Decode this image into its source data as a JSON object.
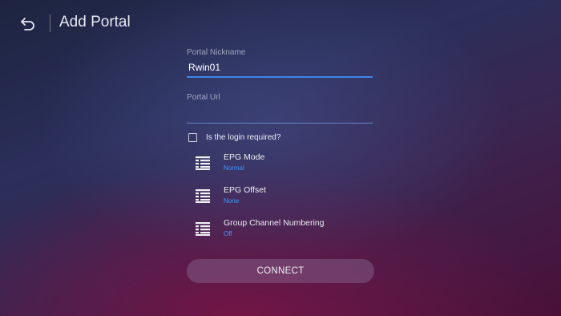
{
  "header": {
    "title": "Add Portal",
    "back_icon": "back-arrow-icon"
  },
  "form": {
    "nickname": {
      "label": "Portal Nickname",
      "value": "Rwin01"
    },
    "url": {
      "label": "Portal Url",
      "value": ""
    },
    "login_required": {
      "label": "Is the login required?",
      "checked": false
    }
  },
  "settings": [
    {
      "name": "EPG Mode",
      "value": "Normal",
      "icon": "list-icon"
    },
    {
      "name": "EPG Offset",
      "value": "None",
      "icon": "list-icon"
    },
    {
      "name": "Group Channel Numbering",
      "value": "Off",
      "icon": "list-icon"
    }
  ],
  "connect_label": "CONNECT",
  "colors": {
    "accent": "#3d86e8",
    "value_text": "#3f97ff"
  }
}
